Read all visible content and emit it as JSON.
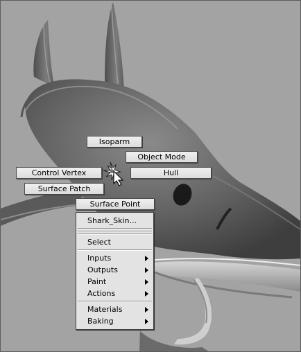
{
  "marking_menu": {
    "north": "Isoparm",
    "north_east": "Object Mode",
    "west": "Control Vertex",
    "east": "Hull",
    "south_west": "Surface Patch",
    "south": "Surface Point"
  },
  "context_menu": {
    "object_name": "Shark_Skin...",
    "select": "Select",
    "items": [
      {
        "label": "Inputs"
      },
      {
        "label": "Outputs"
      },
      {
        "label": "Paint"
      },
      {
        "label": "Actions"
      }
    ],
    "items2": [
      {
        "label": "Materials"
      },
      {
        "label": "Baking"
      }
    ]
  },
  "colors": {
    "viewport_bg": "#a3a3a3",
    "menu_bg": "#e3e3e3",
    "button_bg": "#e8e8e8"
  }
}
